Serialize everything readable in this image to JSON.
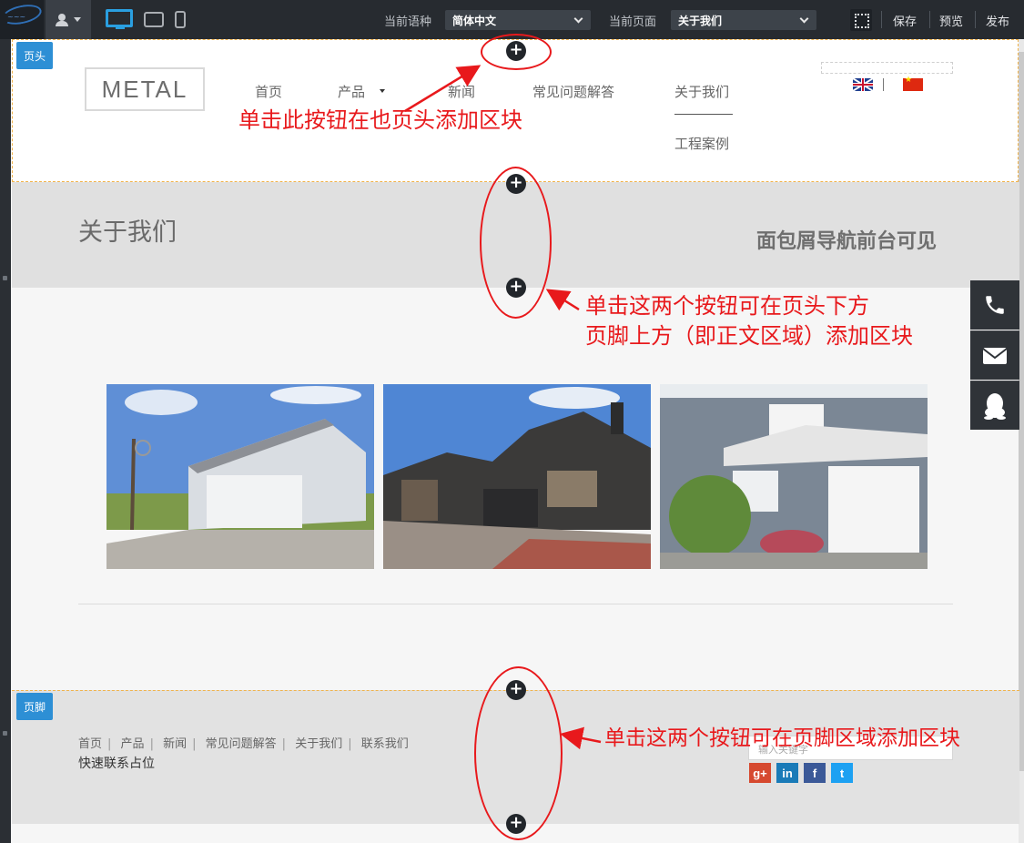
{
  "toolbar": {
    "user_icon": "user-icon",
    "devices": [
      "desktop-icon",
      "tablet-icon",
      "phone-icon"
    ],
    "language_label": "当前语种",
    "language_value": "简体中文",
    "page_label": "当前页面",
    "page_value": "关于我们",
    "grid_icon": "grid-toggle-icon",
    "save": "保存",
    "preview": "预览",
    "publish": "发布"
  },
  "header": {
    "tag": "页头",
    "logo": "METAL",
    "nav": [
      "首页",
      "产品",
      "新闻",
      "常见问题解答",
      "关于我们",
      "工程案例"
    ],
    "active_nav": "关于我们",
    "languages": [
      "uk-flag-icon",
      "cn-flag-icon"
    ],
    "lang_separator": "|"
  },
  "banner": {
    "title": "关于我们",
    "breadcrumb_note": "面包屑导航前台可见"
  },
  "content": {
    "images": [
      "garage-photo",
      "townhouse-photo",
      "stone-house-photo"
    ]
  },
  "float_contact": [
    "phone-icon",
    "mail-icon",
    "qq-icon"
  ],
  "footer": {
    "tag": "页脚",
    "links": [
      "首页",
      "产品",
      "新闻",
      "常见问题解答",
      "关于我们",
      "联系我们"
    ],
    "quick_contact": "快速联系占位",
    "search_placeholder": "输入关键字",
    "social": [
      "google-plus-icon",
      "linkedin-icon",
      "facebook-icon",
      "twitter-icon"
    ],
    "social_labels": [
      "g+",
      "in",
      "f",
      "t"
    ]
  },
  "annotations": {
    "header_hint": "单击此按钮在也页头添加区块",
    "body_hint_line1": "单击这两个按钮可在页头下方",
    "body_hint_line2": "页脚上方（即正文区域）添加区块",
    "footer_hint": "单击这两个按钮可在页脚区域添加区块"
  },
  "add_button_symbol": "+",
  "colors": {
    "accent": "#2d8fd5",
    "annotation": "#e8191c",
    "toolbar_bg": "#272b30"
  }
}
